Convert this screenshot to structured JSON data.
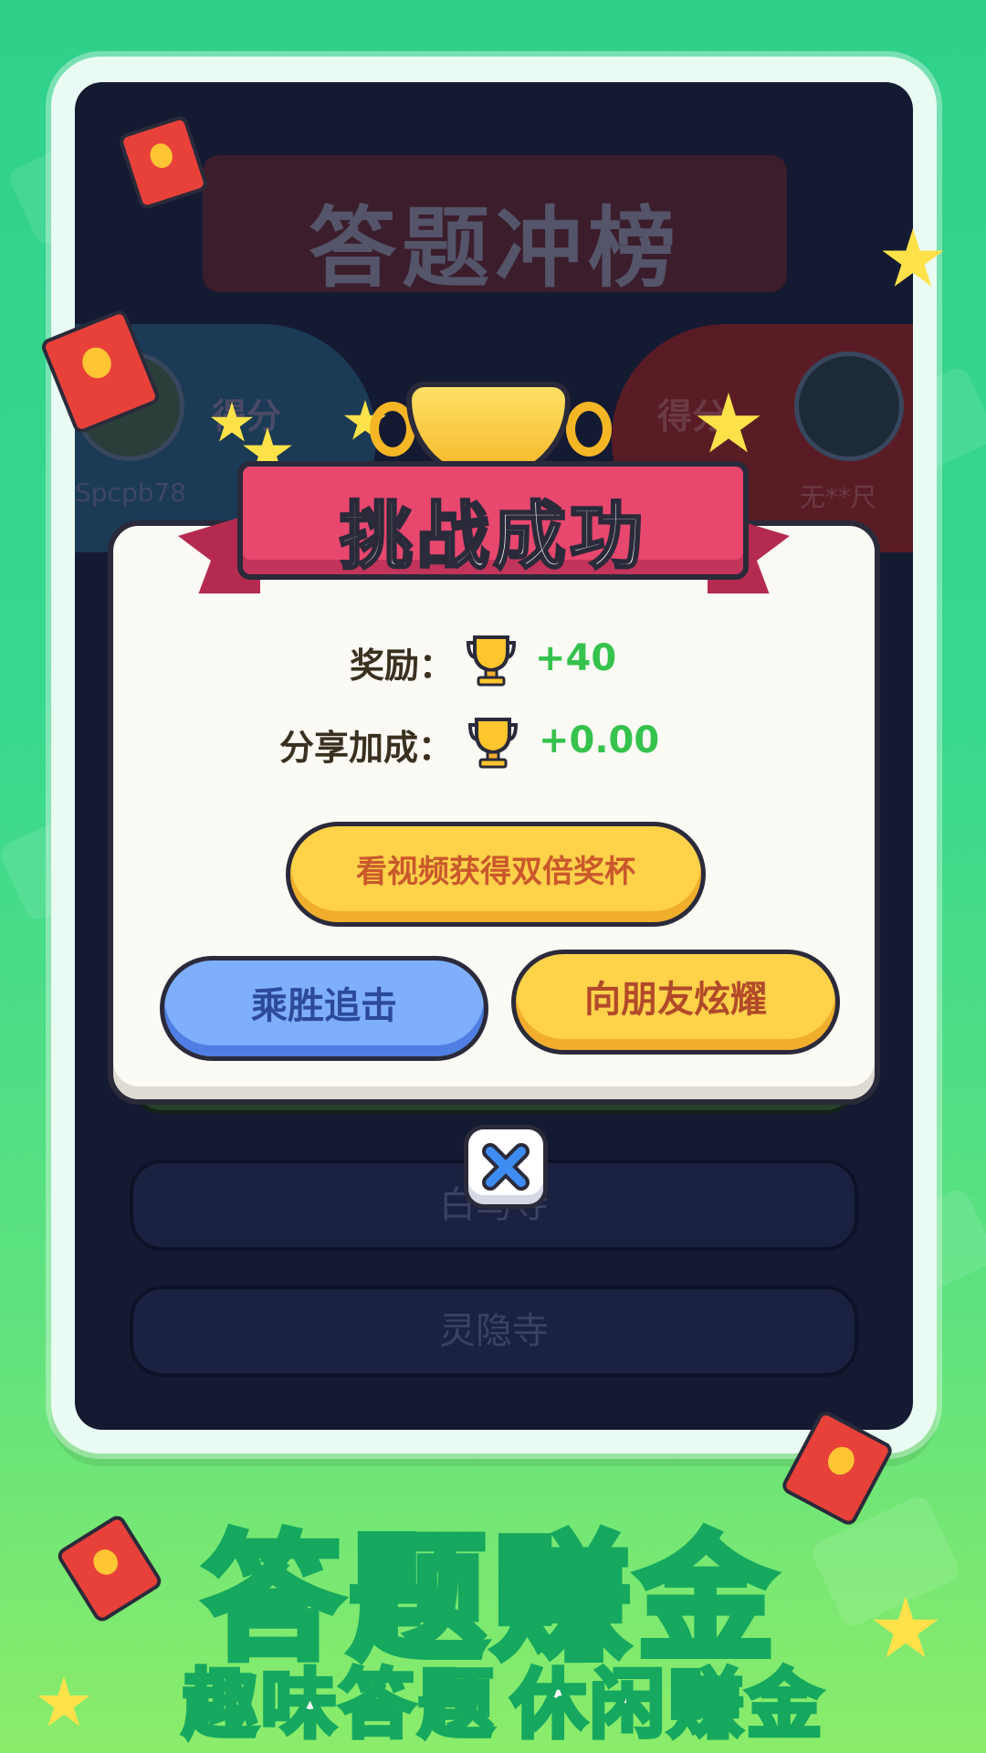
{
  "quiz_screen": {
    "title": "答题冲榜",
    "left_player": {
      "score_label": "得分",
      "name": "Spcpb78"
    },
    "right_player": {
      "score_label": "得分",
      "name": "无**尺"
    },
    "answers": [
      {
        "label": ""
      },
      {
        "label": "白马寺"
      },
      {
        "label": "灵隐寺"
      }
    ]
  },
  "modal": {
    "title": "挑战成功",
    "rewards": [
      {
        "label": "奖励：",
        "value": "+40",
        "icon": "trophy-icon"
      },
      {
        "label": "分享加成：",
        "value": "+0.00",
        "icon": "trophy-icon"
      }
    ],
    "video_button": "看视频获得双倍奖杯",
    "continue_button": "乘胜追击",
    "share_button": "向朋友炫耀"
  },
  "promo": {
    "title": "答题赚金",
    "subtitle_left": "趣味答题",
    "subtitle_right": "休闲赚金"
  },
  "colors": {
    "background": "#38d88e",
    "ribbon": "#e8476e",
    "reward_value": "#35c24d",
    "button_yellow": "#ffd24a",
    "button_blue": "#7eaefc"
  }
}
